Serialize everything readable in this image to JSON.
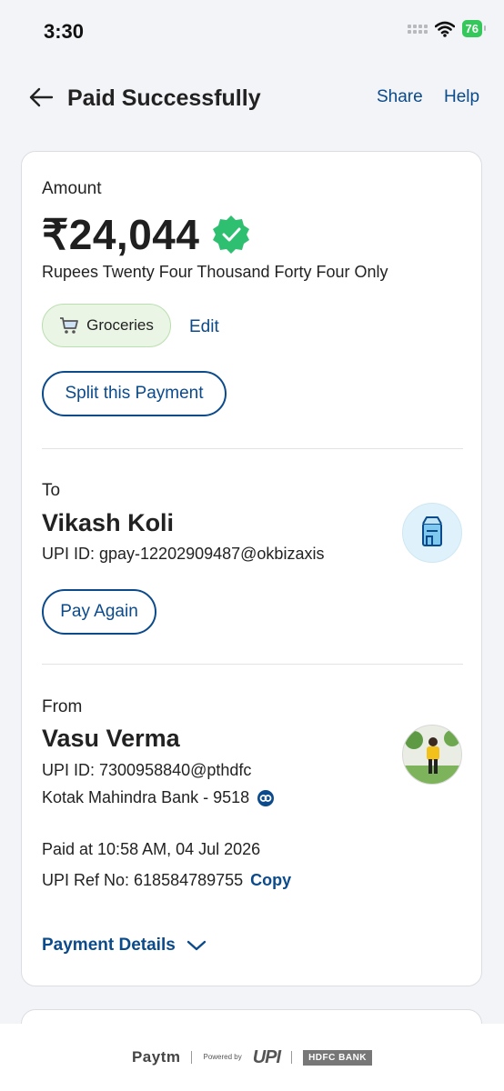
{
  "status": {
    "time": "3:30",
    "battery": "76"
  },
  "header": {
    "title": "Paid Successfully",
    "share": "Share",
    "help": "Help"
  },
  "amount": {
    "label": "Amount",
    "value": "₹24,044",
    "words": "Rupees Twenty Four Thousand Forty Four Only",
    "category": "Groceries",
    "edit": "Edit",
    "split": "Split this Payment"
  },
  "to": {
    "label": "To",
    "name": "Vikash Koli",
    "upi": "UPI ID: gpay-12202909487@okbizaxis",
    "pay_again": "Pay Again"
  },
  "from": {
    "label": "From",
    "name": "Vasu Verma",
    "upi": "UPI ID: 7300958840@pthdfc",
    "bank": "Kotak Mahindra Bank - 9518"
  },
  "meta": {
    "paid_at": "Paid at 10:58 AM, 04 Jul 2026",
    "ref": "UPI Ref No: 618584789755",
    "copy": "Copy",
    "details": "Payment Details"
  },
  "footer": {
    "paytm": "Paytm",
    "powered": "Powered by",
    "upi": "UPI",
    "bank": "HDFC BANK"
  },
  "colors": {
    "accent": "#0b4a8b",
    "success": "#2fbf71",
    "chip_bg": "#eaf5e6"
  },
  "icons": {
    "back": "back-arrow-icon",
    "verified": "verified-badge-icon",
    "cart": "cart-icon",
    "store": "store-icon",
    "bank_link": "bank-link-icon",
    "chevron": "chevron-down-icon"
  }
}
